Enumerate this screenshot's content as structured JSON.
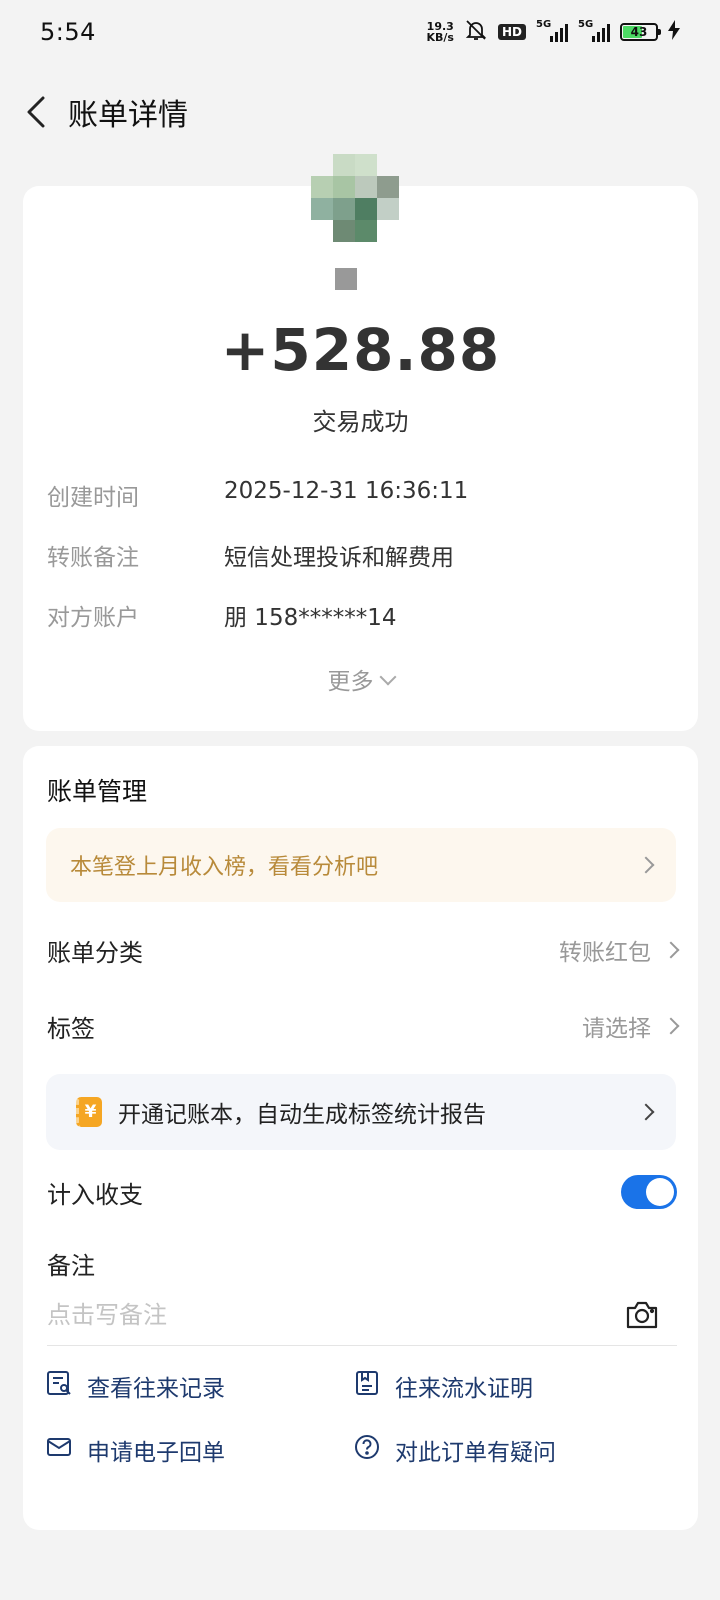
{
  "status_bar": {
    "time": "5:54",
    "net_speed_value": "19.3",
    "net_speed_unit": "KB/s",
    "hd_label": "HD",
    "signal1_label": "5G",
    "signal2_label": "5G",
    "battery_percent": "43"
  },
  "header": {
    "title": "账单详情"
  },
  "summary": {
    "amount": "+528.88",
    "status": "交易成功",
    "details": [
      {
        "label": "创建时间",
        "value": "2025-12-31 16:36:11"
      },
      {
        "label": "转账备注",
        "value": "短信处理投诉和解费用"
      },
      {
        "label": "对方账户",
        "value": "朋 158******14"
      }
    ],
    "more_label": "更多"
  },
  "manage": {
    "title": "账单管理",
    "promo_text": "本笔登上月收入榜，看看分析吧",
    "category_label": "账单分类",
    "category_value": "转账红包",
    "tag_label": "标签",
    "tag_value": "请选择",
    "notebook_text": "开通记账本，自动生成标签统计报告",
    "notebook_icon_char": "¥",
    "include_label": "计入收支",
    "include_enabled": true,
    "remark_label": "备注",
    "remark_placeholder": "点击写备注",
    "actions": [
      {
        "label": "查看往来记录",
        "icon": "record-search-icon"
      },
      {
        "label": "往来流水证明",
        "icon": "statement-icon"
      },
      {
        "label": "申请电子回单",
        "icon": "mail-icon"
      },
      {
        "label": "对此订单有疑问",
        "icon": "question-icon"
      }
    ]
  },
  "colors": {
    "accent": "#1a73e8",
    "promo_text": "#b88a3a",
    "action_text": "#1e3a6e",
    "background": "#f3f3f3"
  }
}
